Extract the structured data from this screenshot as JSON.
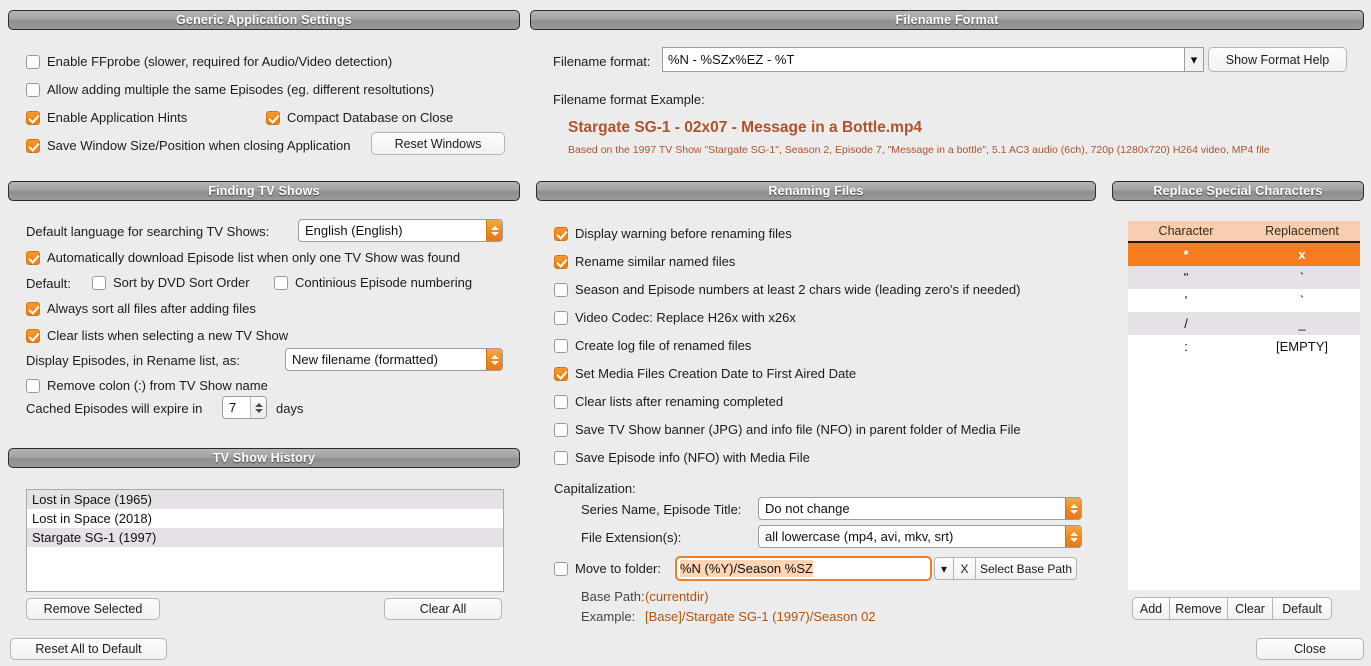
{
  "generic": {
    "title": "Generic Application Settings",
    "options": [
      {
        "label": "Enable FFprobe (slower, required for Audio/Video detection)",
        "checked": false
      },
      {
        "label": "Allow adding multiple the same Episodes (eg. different resoltutions)",
        "checked": false
      },
      {
        "label": "Enable Application Hints",
        "checked": true
      },
      {
        "label": "Compact Database on Close",
        "checked": true
      },
      {
        "label": "Save Window Size/Position when closing Application",
        "checked": true
      }
    ],
    "reset_windows_button": "Reset Windows"
  },
  "finding": {
    "title": "Finding TV Shows",
    "language_label": "Default language for searching TV Shows:",
    "language_value": "English (English)",
    "auto_download": {
      "label": "Automatically download Episode list when only one TV Show was found",
      "checked": true
    },
    "default_label": "Default:",
    "sort_dvd": {
      "label": "Sort by DVD Sort Order",
      "checked": false
    },
    "continuous": {
      "label": "Continious Episode numbering",
      "checked": false
    },
    "always_sort": {
      "label": "Always sort all files after adding files",
      "checked": true
    },
    "clear_lists": {
      "label": "Clear lists when selecting a new TV Show",
      "checked": true
    },
    "display_label": "Display Episodes, in Rename list, as:",
    "display_value": "New filename (formatted)",
    "remove_colon": {
      "label": "Remove colon (:) from TV Show name",
      "checked": false
    },
    "cache_label_pre": "Cached Episodes will expire in",
    "cache_value": "7",
    "cache_label_post": "days"
  },
  "history": {
    "title": "TV Show History",
    "items": [
      "Lost in Space (1965)",
      "Lost in Space (2018)",
      "Stargate SG-1 (1997)"
    ],
    "remove_selected_button": "Remove Selected",
    "clear_all_button": "Clear All"
  },
  "reset_all_button": "Reset All to Default",
  "filename_format": {
    "title": "Filename Format",
    "field_label": "Filename format:",
    "field_value": "%N - %SZx%EZ - %T",
    "show_help_button": "Show Format Help",
    "example_label": "Filename format Example:",
    "example_filename": "Stargate SG-1 - 02x07 - Message in a Bottle.mp4",
    "example_description": "Based on the 1997 TV Show \"Stargate SG-1\", Season 2, Episode 7, \"Message in a bottle\", 5.1 AC3 audio (6ch), 720p (1280x720) H264 video, MP4 file"
  },
  "renaming": {
    "title": "Renaming Files",
    "options": [
      {
        "label": "Display warning before renaming files",
        "checked": true
      },
      {
        "label": "Rename similar named files",
        "checked": true
      },
      {
        "label": "Season and Episode numbers at least 2 chars wide (leading zero's if needed)",
        "checked": false
      },
      {
        "label": "Video Codec: Replace H26x with x26x",
        "checked": false
      },
      {
        "label": "Create log file of renamed files",
        "checked": false
      },
      {
        "label": "Set Media Files Creation Date to First Aired Date",
        "checked": true
      },
      {
        "label": "Clear lists after renaming completed",
        "checked": false
      },
      {
        "label": "Save TV Show banner (JPG) and info file (NFO) in parent folder of Media File",
        "checked": false
      },
      {
        "label": "Save Episode info (NFO) with Media File",
        "checked": false
      }
    ],
    "capitalization_label": "Capitalization:",
    "series_label": "Series Name, Episode Title:",
    "series_value": "Do not change",
    "extension_label": "File Extension(s):",
    "extension_value": "all lowercase (mp4, avi, mkv, srt)",
    "move_to_folder": {
      "label": "Move to folder:",
      "checked": false
    },
    "move_value": "%N (%Y)/Season %SZ",
    "clear_button": "X",
    "select_base_path_button": "Select Base Path",
    "base_path_label": "Base Path:",
    "base_path_value": "(currentdir)",
    "example_label": "Example:",
    "example_value": "[Base]/Stargate SG-1 (1997)/Season 02"
  },
  "replace": {
    "title": "Replace Special Characters",
    "columns": [
      "Character",
      "Replacement"
    ],
    "rows": [
      {
        "character": "*",
        "replacement": "x",
        "selected": true
      },
      {
        "character": "\"",
        "replacement": "`",
        "selected": false
      },
      {
        "character": "'",
        "replacement": "`",
        "selected": false
      },
      {
        "character": "/",
        "replacement": "_",
        "selected": false
      },
      {
        "character": ":",
        "replacement": "[EMPTY]",
        "selected": false
      }
    ],
    "buttons": [
      "Add",
      "Remove",
      "Clear",
      "Default"
    ]
  },
  "close_button": "Close"
}
